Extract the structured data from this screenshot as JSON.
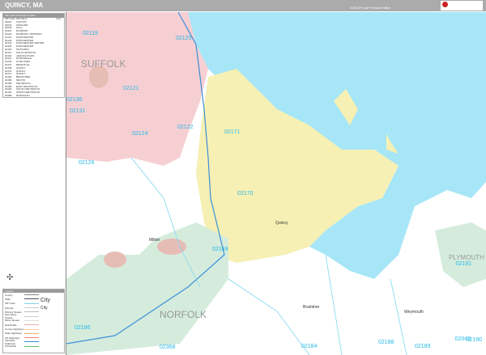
{
  "header": {
    "title": "QUINCY, MA",
    "edition": "2025 ZIP Code Premium Edition",
    "logo_text": "MarketMAPS"
  },
  "index": {
    "title": "ZIP Code Index/City Locator",
    "columns": [
      "ZIP Code",
      "ZIP Name",
      "LOC"
    ],
    "rows": [
      [
        "02021",
        "CANTON"
      ],
      [
        "02043",
        "HINGHAM"
      ],
      [
        "02045",
        "HULL"
      ],
      [
        "02119",
        "ROXBURY"
      ],
      [
        "02120",
        "ROXBURY CROSSING"
      ],
      [
        "02121",
        "DORCHESTER"
      ],
      [
        "02122",
        "DORCHESTER"
      ],
      [
        "02124",
        "DORCHESTER CENTER"
      ],
      [
        "02125",
        "DORCHESTER"
      ],
      [
        "02126",
        "MATTAPAN"
      ],
      [
        "02127",
        "SOUTH BOSTON"
      ],
      [
        "02130",
        "JAMAICA PLAIN"
      ],
      [
        "02131",
        "ROSLINDALE"
      ],
      [
        "02136",
        "HYDE PARK"
      ],
      [
        "02137",
        "READVILLE"
      ],
      [
        "02169",
        "QUINCY"
      ],
      [
        "02170",
        "QUINCY"
      ],
      [
        "02171",
        "QUINCY"
      ],
      [
        "02184",
        "BRAINTREE"
      ],
      [
        "02186",
        "MILTON"
      ],
      [
        "02188",
        "WEYMOUTH"
      ],
      [
        "02189",
        "EAST WEYMOUTH"
      ],
      [
        "02190",
        "SOUTH WEYMOUTH"
      ],
      [
        "02191",
        "NORTH WEYMOUTH"
      ],
      [
        "02368",
        "RANDOLPH"
      ]
    ]
  },
  "legend": {
    "title": "Legend",
    "items": [
      {
        "label": "County",
        "color": "#888888"
      },
      {
        "label": "State",
        "color": "#555555"
      },
      {
        "label": "ZIP Code",
        "color": "#7fd8f0"
      },
      {
        "label": "Schools",
        "color": "#cccccc"
      },
      {
        "label": "Primary Streets",
        "color": "#bbbbbb"
      },
      {
        "label": "Secondary Streets",
        "color": "#cccccc"
      },
      {
        "label": "Minor Streets",
        "color": "#dddddd"
      },
      {
        "label": "Rail Roads",
        "color": "#e8b0b0"
      },
      {
        "label": "County Highways",
        "color": "#f0c8a0"
      },
      {
        "label": "State Highways",
        "color": "#f5b060"
      },
      {
        "label": "US Highways",
        "color": "#f08080"
      },
      {
        "label": "Interstate Highways",
        "color": "#3a8fd8"
      },
      {
        "label": "Toll Roads",
        "color": "#60c060"
      }
    ],
    "city_label": "City"
  },
  "map": {
    "colors": {
      "water": "#a6e6f7",
      "suffolk": "#f6cfd3",
      "quincy": "#f6f0b4",
      "park": "#d5ecdd",
      "land": "#ffffff",
      "golf": "#e6bdb5"
    },
    "counties": [
      "SUFFOLK",
      "NORFOLK",
      "PLYMOUTH"
    ],
    "cities": [
      "Quincy",
      "Braintree",
      "Weymouth",
      "Milton"
    ],
    "zips": [
      "02119",
      "02125",
      "02121",
      "02136",
      "02131",
      "02124",
      "02122",
      "02171",
      "02126",
      "02170",
      "02169",
      "02186",
      "02368",
      "02184",
      "02188",
      "02189",
      "02190",
      "02191",
      "02043"
    ]
  }
}
